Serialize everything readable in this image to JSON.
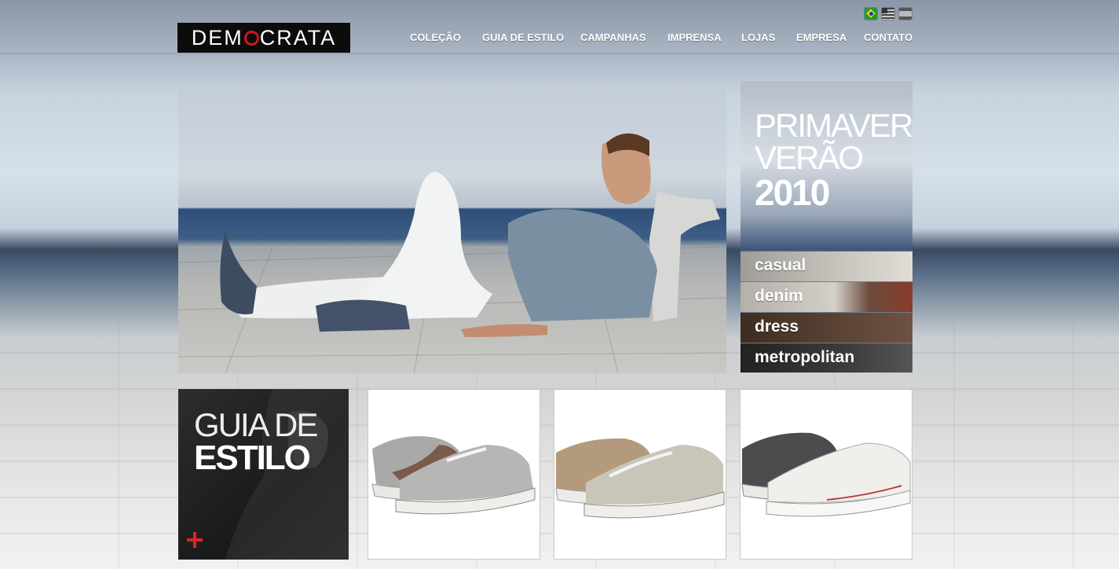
{
  "brand": {
    "logo_text_before": "DEM",
    "logo_text_after": "CRATA"
  },
  "languages": [
    "pt-BR",
    "en-US",
    "es"
  ],
  "nav": {
    "items": [
      {
        "label": "COLEÇÃO"
      },
      {
        "label": "GUIA DE ESTILO"
      },
      {
        "label": "CAMPANHAS"
      },
      {
        "label": "IMPRENSA"
      },
      {
        "label": "LOJAS"
      },
      {
        "label": "EMPRESA"
      },
      {
        "label": "CONTATO"
      }
    ]
  },
  "season": {
    "line1": "PRIMAVERA",
    "line2": "VERÃO",
    "year": "2010"
  },
  "categories": [
    {
      "label": "casual"
    },
    {
      "label": "denim"
    },
    {
      "label": "dress"
    },
    {
      "label": "metropolitan"
    }
  ],
  "guide": {
    "line1": "GUIA DE",
    "line2": "ESTILO"
  },
  "colors": {
    "accent": "#d4161c",
    "logo_bg": "#0c0c0c"
  },
  "icons": {
    "more": "plus-icon"
  }
}
